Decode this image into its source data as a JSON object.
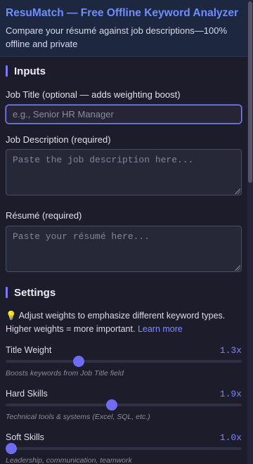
{
  "header": {
    "title": "ResuMatch — Free Offline Keyword Analyzer",
    "subtitle": "Compare your résumé against job descriptions—100% offline and private"
  },
  "inputs_section": {
    "title": "Inputs",
    "job_title": {
      "label": "Job Title (optional — adds weighting boost)",
      "placeholder": "e.g., Senior HR Manager",
      "value": ""
    },
    "job_description": {
      "label": "Job Description (required)",
      "placeholder": "Paste the job description here...",
      "value": ""
    },
    "resume": {
      "label": "Résumé (required)",
      "placeholder": "Paste your résumé here...",
      "value": ""
    }
  },
  "settings_section": {
    "title": "Settings",
    "tip_icon": "lightbulb-icon",
    "tip_text": "Adjust weights to emphasize different keyword types. Higher weights = more important.",
    "learn_more": "Learn more",
    "sliders": [
      {
        "label": "Title Weight",
        "value_text": "1.3x",
        "level": 0.31,
        "hint": "Boosts keywords from Job Title field"
      },
      {
        "label": "Hard Skills",
        "value_text": "1.9x",
        "level": 0.45,
        "hint": "Technical tools & systems (Excel, SQL, etc.)"
      },
      {
        "label": "Soft Skills",
        "value_text": "1.0x",
        "level": 0.0,
        "hint": "Leadership, communication, teamwork"
      }
    ]
  },
  "colors": {
    "accent": "#6e8dff",
    "slider_thumb": "#6f6cf4",
    "background": "#1c1c2a",
    "header_bg": "#1d2740"
  }
}
